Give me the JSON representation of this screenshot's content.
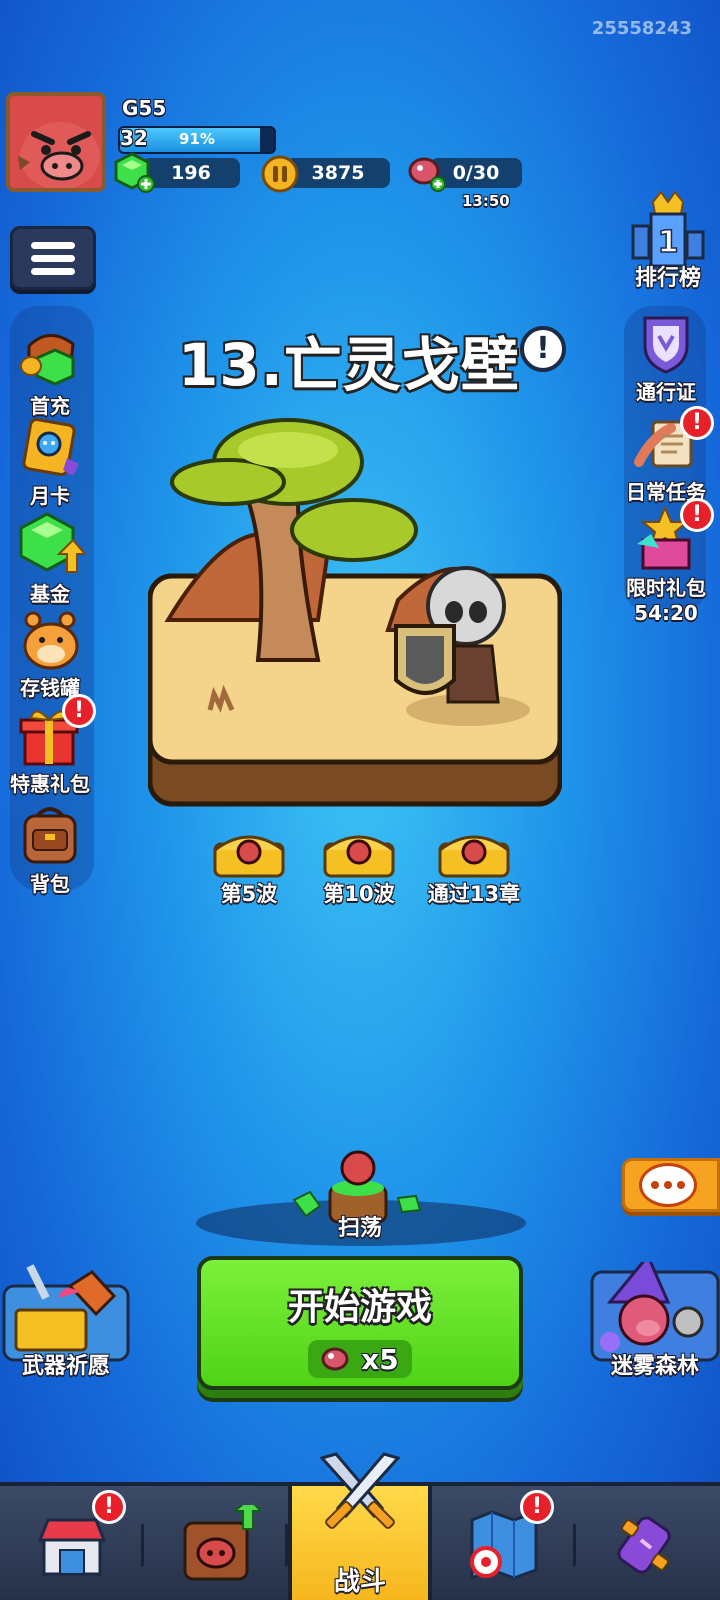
{
  "player_id": "25558243",
  "header": {
    "name": "G55",
    "level": "32",
    "xp_percent": "91%",
    "xp_fraction": 0.91,
    "gems": "196",
    "coins": "3875",
    "energy": "0/30",
    "energy_timer": "13:50"
  },
  "left_menu": [
    {
      "label": "首充"
    },
    {
      "label": "月卡"
    },
    {
      "label": "基金"
    },
    {
      "label": "存钱罐"
    },
    {
      "label": "特惠礼包",
      "badge": "!"
    },
    {
      "label": "背包"
    }
  ],
  "right_menu": {
    "leaderboard": "排行榜",
    "leaderboard_rank": "1",
    "items": [
      {
        "label": "通行证"
      },
      {
        "label": "日常任务",
        "badge": "!"
      },
      {
        "label": "限时礼包",
        "badge": "!",
        "timer": "54:20"
      }
    ]
  },
  "chapter": {
    "title": "13.亡灵戈壁",
    "info_icon": "!"
  },
  "chests": [
    {
      "label": "第5波"
    },
    {
      "label": "第10波"
    },
    {
      "label": "通过13章"
    }
  ],
  "sweep_label": "扫荡",
  "start_button": {
    "label": "开始游戏",
    "cost": "x5"
  },
  "weapon_wish_label": "武器祈愿",
  "fog_forest_label": "迷雾森林",
  "bottom_nav": {
    "shop_badge": "!",
    "map_badge": "!",
    "battle_label": "战斗"
  },
  "colors": {
    "background": "#1f95ea",
    "start_green": "#5fe023",
    "badge_red": "#e8202a",
    "nav_active": "#f6b51c"
  }
}
